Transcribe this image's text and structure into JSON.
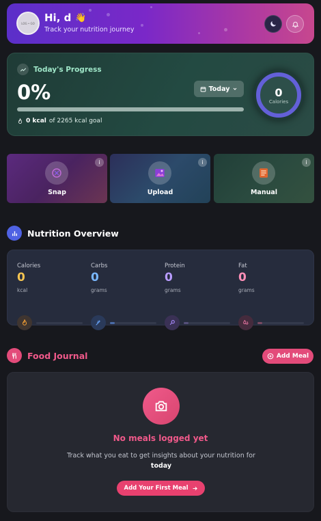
{
  "header": {
    "avatar_text": "LOG • GO",
    "greeting": "Hi, d",
    "wave_emoji": "👋",
    "subtitle": "Track your nutrition journey",
    "icons": [
      "moon-icon",
      "bell-icon"
    ]
  },
  "progress": {
    "title": "Today's Progress",
    "percent_text": "0%",
    "percent": 0,
    "range_label": "Today",
    "kcal_consumed": "0 kcal",
    "kcal_goal_text": "of 2265 kcal goal",
    "ring_value": "0",
    "ring_label": "Calories"
  },
  "actions": [
    {
      "label": "Snap",
      "icon": "camera-scan-icon"
    },
    {
      "label": "Upload",
      "icon": "image-upload-icon"
    },
    {
      "label": "Manual",
      "icon": "notepad-icon"
    }
  ],
  "nutrition": {
    "title": "Nutrition Overview",
    "items": [
      {
        "label": "Calories",
        "value": "0",
        "unit": "kcal",
        "color": "#f5c451",
        "icon": "flame-icon"
      },
      {
        "label": "Carbs",
        "value": "0",
        "unit": "grams",
        "color": "#7ab8ff",
        "icon": "wheat-icon"
      },
      {
        "label": "Protein",
        "value": "0",
        "unit": "grams",
        "color": "#b89cff",
        "icon": "drumstick-icon"
      },
      {
        "label": "Fat",
        "value": "0",
        "unit": "grams",
        "color": "#ff8fb8",
        "icon": "droplets-icon"
      }
    ]
  },
  "journal": {
    "title": "Food Journal",
    "add_label": "Add Meal",
    "empty_title": "No meals logged yet",
    "empty_sub": "Track what you eat to get insights about your nutrition for",
    "empty_sub_bold": "today",
    "cta": "Add Your First Meal"
  },
  "colors": {
    "accent_pink": "#e34b7a",
    "accent_green": "#9fe6c8",
    "ring": "#6360d8",
    "bg": "#17181d"
  }
}
